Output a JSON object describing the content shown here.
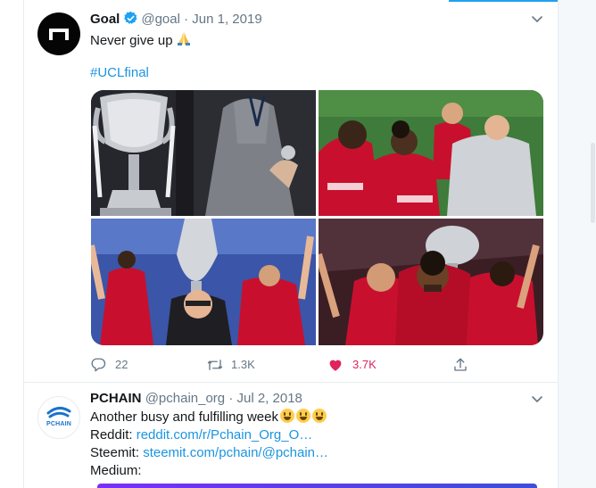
{
  "tweets": [
    {
      "author": "Goal",
      "handle": "@goal",
      "separator": "·",
      "date": "Jun 1, 2019",
      "text": "Never give up",
      "hashtag": "#UCLfinal",
      "actions": {
        "reply": "22",
        "retweet": "1.3K",
        "like": "3.7K"
      },
      "liked": true
    },
    {
      "author": "PCHAIN",
      "handle": "@pchain_org",
      "separator": "·",
      "date": "Jul 2, 2018",
      "avatar_text": "PCHAIN",
      "text": "Another busy and fulfilling week",
      "reddit_label": "Reddit:",
      "reddit_link": "reddit.com/r/Pchain_Org_O…",
      "steemit_label": "Steemit:",
      "steemit_link": "steemit.com/pchain/@pchain…",
      "medium_label": "Medium:"
    }
  ],
  "colors": {
    "accent": "#1da1f2",
    "like": "#e0245e",
    "link": "#1b95e0",
    "muted": "#657786"
  }
}
